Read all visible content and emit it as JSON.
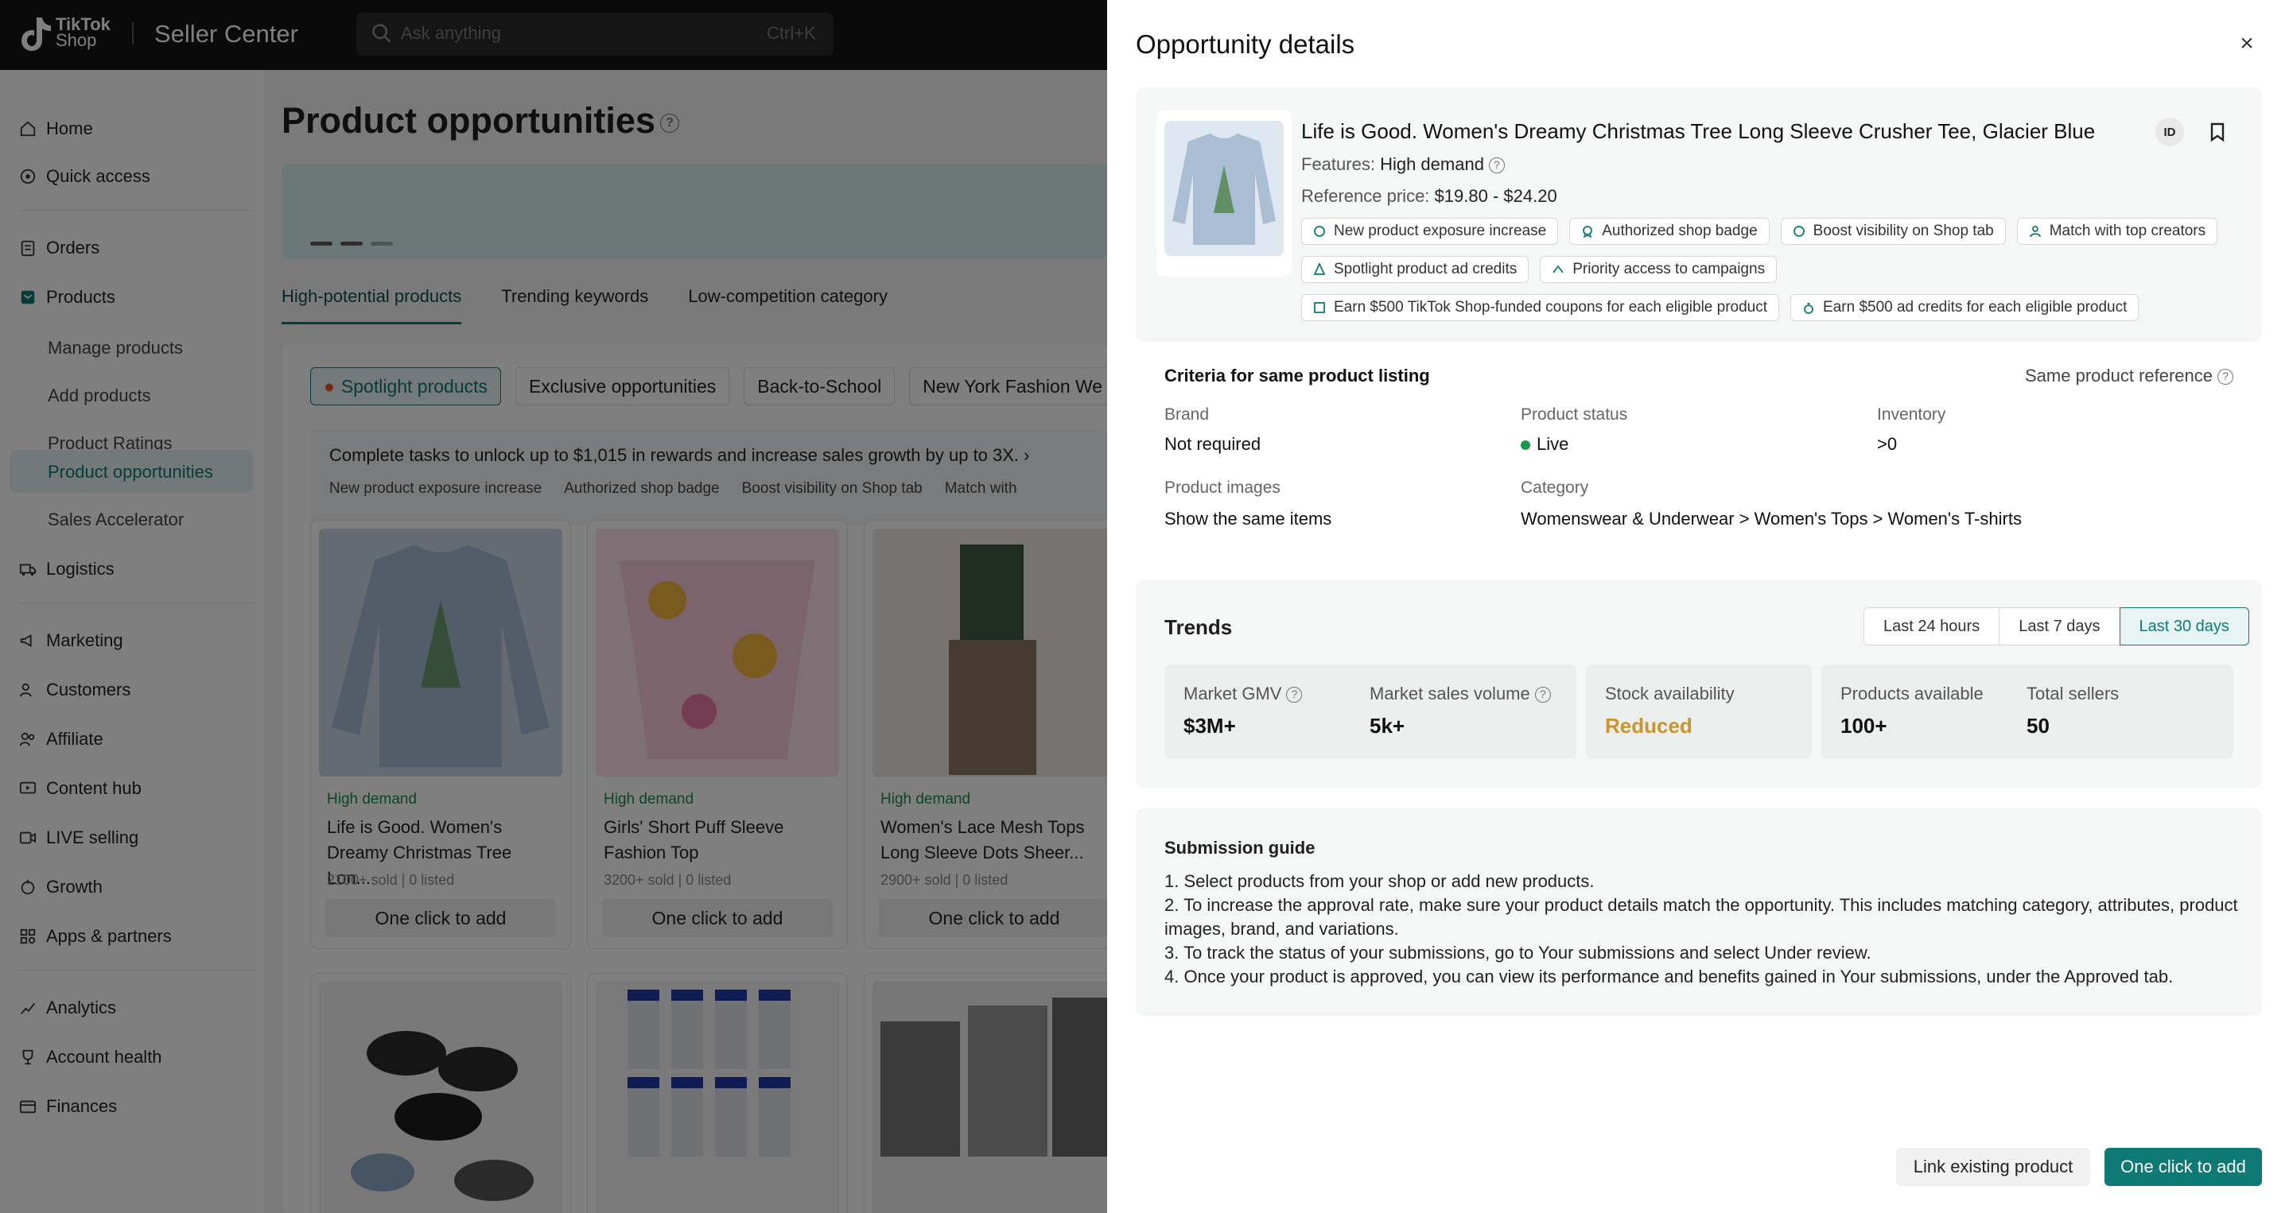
{
  "app": {
    "brand": "TikTok Shop",
    "brand_line1": "TikTok",
    "brand_line2": "Shop",
    "title": "Seller Center"
  },
  "search": {
    "placeholder": "Ask anything",
    "shortcut": "Ctrl+K"
  },
  "sidebar": {
    "items": [
      {
        "label": "Home",
        "icon": "home-icon"
      },
      {
        "label": "Quick access",
        "icon": "compass-icon"
      },
      {
        "label": "Orders",
        "icon": "clipboard-icon"
      },
      {
        "label": "Products",
        "icon": "box-icon"
      },
      {
        "label": "Logistics",
        "icon": "truck-icon"
      },
      {
        "label": "Marketing",
        "icon": "megaphone-icon"
      },
      {
        "label": "Customers",
        "icon": "people-icon"
      },
      {
        "label": "Affiliate",
        "icon": "handshake-icon"
      },
      {
        "label": "Content hub",
        "icon": "monitor-icon"
      },
      {
        "label": "LIVE selling",
        "icon": "live-icon"
      },
      {
        "label": "Growth",
        "icon": "growth-icon"
      },
      {
        "label": "Apps & partners",
        "icon": "apps-icon"
      },
      {
        "label": "Analytics",
        "icon": "chart-icon"
      },
      {
        "label": "Account health",
        "icon": "trophy-icon"
      },
      {
        "label": "Finances",
        "icon": "wallet-icon"
      }
    ],
    "product_sub": [
      "Manage products",
      "Add products",
      "Product Ratings",
      "Product opportunities",
      "Sales Accelerator"
    ]
  },
  "main": {
    "title": "Product opportunities",
    "tabs": [
      "High-potential products",
      "Trending keywords",
      "Low-competition category"
    ],
    "chips": [
      "Spotlight products",
      "Exclusive opportunities",
      "Back-to-School",
      "New York Fashion We"
    ],
    "tasks_text": "Complete tasks to unlock up to $1,015 in rewards and increase sales growth by up to 3X.",
    "task_features": [
      "New product exposure increase",
      "Authorized shop badge",
      "Boost visibility on Shop tab",
      "Match with"
    ],
    "products": [
      {
        "badge": "High demand",
        "name": "Life is Good. Women's Dreamy Christmas Tree Lon...",
        "sold": "2100+ sold",
        "listed": "0 listed",
        "button": "One click to add"
      },
      {
        "badge": "High demand",
        "name": "Girls' Short Puff Sleeve Fashion Top",
        "sold": "3200+ sold",
        "listed": "0 listed",
        "button": "One click to add"
      },
      {
        "badge": "High demand",
        "name": "Women's Lace Mesh Tops Long Sleeve Dots Sheer...",
        "sold": "2900+ sold",
        "listed": "0 listed",
        "button": "One click to add"
      }
    ]
  },
  "drawer": {
    "title": "Opportunity details",
    "product": {
      "name": "Life is Good. Women's Dreamy Christmas Tree Long Sleeve Crusher Tee, Glacier Blue",
      "features_label": "Features:",
      "features_value": "High demand",
      "price_label": "Reference price:",
      "price_value": "$19.80 - $24.20",
      "id_label": "ID",
      "benefits": [
        "New product exposure increase",
        "Authorized shop badge",
        "Boost visibility on Shop tab",
        "Match with top creators",
        "Spotlight product ad credits",
        "Priority access to campaigns",
        "Earn $500 TikTok Shop-funded coupons for each eligible product",
        "Earn $500 ad credits for each eligible product"
      ]
    },
    "criteria": {
      "title": "Criteria for same product listing",
      "reference": "Same product reference",
      "brand_label": "Brand",
      "brand_value": "Not required",
      "status_label": "Product status",
      "status_value": "Live",
      "inventory_label": "Inventory",
      "inventory_value": ">0",
      "images_label": "Product images",
      "images_value": "Show the same items",
      "category_label": "Category",
      "category_value": "Womenswear & Underwear > Women's Tops > Women's T-shirts"
    },
    "trends": {
      "title": "Trends",
      "ranges": [
        "Last 24 hours",
        "Last 7 days",
        "Last 30 days"
      ],
      "selected_range": "Last 30 days",
      "metrics": {
        "gmv_label": "Market GMV",
        "gmv_value": "$3M+",
        "volume_label": "Market sales volume",
        "volume_value": "5k+",
        "stock_label": "Stock availability",
        "stock_value": "Reduced",
        "products_label": "Products available",
        "products_value": "100+",
        "sellers_label": "Total sellers",
        "sellers_value": "50"
      }
    },
    "guide": {
      "title": "Submission guide",
      "steps": [
        "1. Select products from your shop or add new products.",
        "2. To increase the approval rate, make sure your product details match the opportunity. This includes matching category, attributes, product images, brand, and variations.",
        "3. To track the status of your submissions, go to Your submissions and select Under review.",
        "4. Once your product is approved, you can view its performance and benefits gained in Your submissions, under the Approved tab."
      ]
    },
    "buttons": {
      "secondary": "Link existing product",
      "primary": "One click to add"
    }
  },
  "colors": {
    "accent": "#0f7a73",
    "stock_reduced": "#c9962e",
    "live": "#1a9a4a"
  }
}
